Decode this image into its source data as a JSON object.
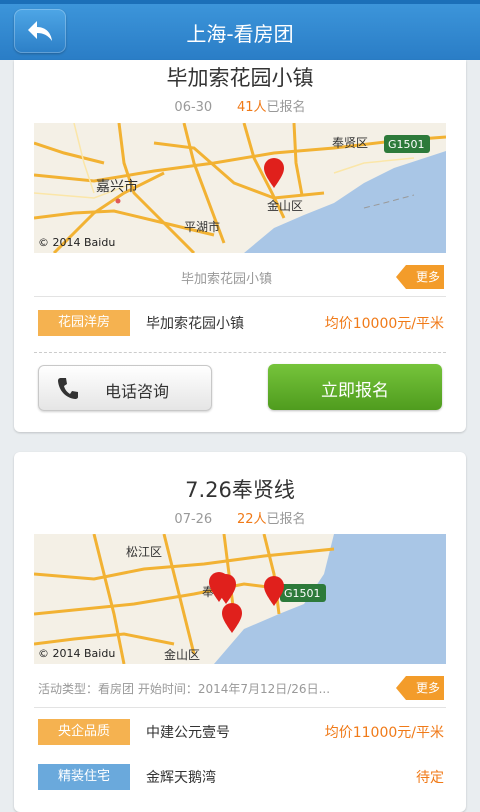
{
  "header": {
    "title": "上海-看房团",
    "back_icon": "back-arrow-icon"
  },
  "events": [
    {
      "title": "毕加索花园小镇",
      "date": "06-30",
      "signup_count": "41人",
      "signup_suffix": "已报名",
      "map_copyright": "© 2014 Baidu",
      "map_labels": [
        "嘉兴市",
        "平湖市",
        "金山区",
        "奉贤区",
        "G1501"
      ],
      "caption": "毕加索花园小镇",
      "more_label": "更多",
      "listing": {
        "tag": "花园洋房",
        "name": "毕加索花园小镇",
        "price": "均价10000元/平米"
      },
      "call_label": "电话咨询",
      "register_label": "立即报名"
    },
    {
      "title": "7.26奉贤线",
      "date": "07-26",
      "signup_count": "22人",
      "signup_suffix": "已报名",
      "map_copyright": "© 2014 Baidu",
      "map_labels": [
        "松江区",
        "奉",
        "G1501",
        "金山区"
      ],
      "caption": "活动类型：看房团  开始时间：2014年7月12日/26日...",
      "more_label": "更多",
      "listings": [
        {
          "tag": "央企品质",
          "name": "中建公元壹号",
          "price": "均价11000元/平米"
        },
        {
          "tag": "精装住宅",
          "name": "金辉天鹅湾",
          "price": "待定"
        }
      ]
    }
  ],
  "colors": {
    "header": "#2a7dc6",
    "accent": "#f07a18",
    "register": "#5aa928",
    "tag_orange": "#f5b250",
    "tag_blue": "#6aa9dc"
  }
}
